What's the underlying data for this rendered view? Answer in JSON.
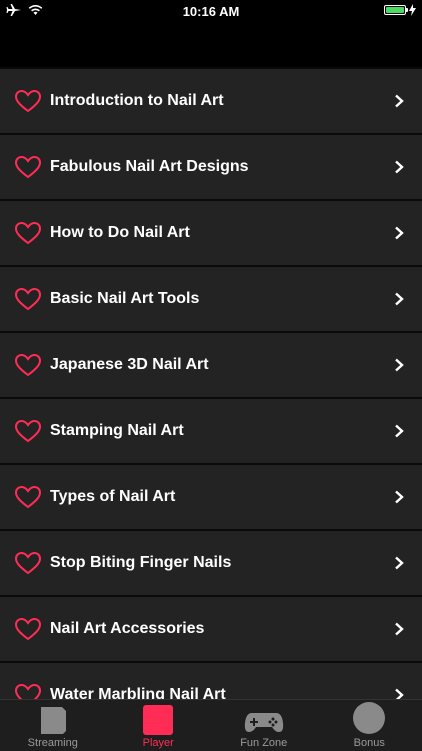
{
  "status_bar": {
    "time": "10:16 AM"
  },
  "colors": {
    "accent": "#ff2d55",
    "row_bg": "#232323",
    "separator": "#0a0a0a",
    "battery": "#4cd964"
  },
  "list": {
    "items": [
      {
        "label": "Introduction to Nail Art"
      },
      {
        "label": "Fabulous Nail Art Designs"
      },
      {
        "label": "How to Do Nail Art"
      },
      {
        "label": "Basic Nail Art Tools"
      },
      {
        "label": "Japanese 3D Nail Art"
      },
      {
        "label": "Stamping Nail Art"
      },
      {
        "label": "Types of Nail Art"
      },
      {
        "label": "Stop Biting Finger Nails"
      },
      {
        "label": "Nail Art Accessories"
      },
      {
        "label": "Water Marbling Nail Art"
      }
    ]
  },
  "tabbar": {
    "tabs": [
      {
        "label": "Streaming",
        "icon": "document-icon",
        "active": false
      },
      {
        "label": "Player",
        "icon": "square-icon",
        "active": true
      },
      {
        "label": "Fun Zone",
        "icon": "gamepad-icon",
        "active": false
      },
      {
        "label": "Bonus",
        "icon": "circle-icon",
        "active": false
      }
    ]
  }
}
